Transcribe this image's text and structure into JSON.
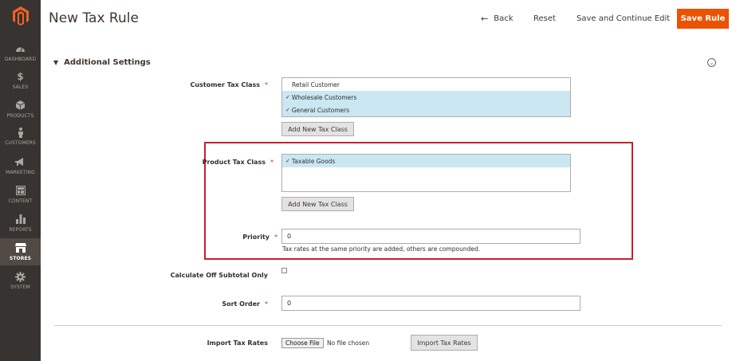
{
  "sidebar": {
    "logo_icon": "magento-logo-icon",
    "items": [
      {
        "label": "DASHBOARD",
        "icon": "dashboard-icon"
      },
      {
        "label": "SALES",
        "icon": "dollar-icon"
      },
      {
        "label": "PRODUCTS",
        "icon": "cube-icon"
      },
      {
        "label": "CUSTOMERS",
        "icon": "person-icon"
      },
      {
        "label": "MARKETING",
        "icon": "megaphone-icon"
      },
      {
        "label": "CONTENT",
        "icon": "layout-icon"
      },
      {
        "label": "REPORTS",
        "icon": "bar-chart-icon"
      },
      {
        "label": "STORES",
        "icon": "store-icon",
        "active": true
      },
      {
        "label": "SYSTEM",
        "icon": "gear-icon"
      }
    ]
  },
  "header": {
    "title": "New Tax Rule",
    "back_label": "Back",
    "reset_label": "Reset",
    "save_continue_label": "Save and Continue Edit",
    "save_rule_label": "Save Rule"
  },
  "section": {
    "title": "Additional Settings"
  },
  "fields": {
    "customer_tax_class": {
      "label": "Customer Tax Class",
      "options": [
        {
          "label": "Retail Customer",
          "selected": false
        },
        {
          "label": "Wholesale Customers",
          "selected": true
        },
        {
          "label": "General Customers",
          "selected": true
        }
      ],
      "add_button": "Add New Tax Class"
    },
    "product_tax_class": {
      "label": "Product Tax Class",
      "options": [
        {
          "label": "Taxable Goods",
          "selected": true
        }
      ],
      "add_button": "Add New Tax Class"
    },
    "priority": {
      "label": "Priority",
      "value": "0",
      "note": "Tax rates at the same priority are added, others are compounded."
    },
    "calc_off_subtotal": {
      "label": "Calculate Off Subtotal Only",
      "checked": false
    },
    "sort_order": {
      "label": "Sort Order",
      "value": "0"
    },
    "import_tax_rates": {
      "label": "Import Tax Rates",
      "choose_file": "Choose File",
      "no_file": "No file chosen",
      "import_button": "Import Tax Rates"
    }
  },
  "colors": {
    "sidebar_bg": "#373330",
    "accent": "#eb5202",
    "selected_option": "#cae7f2",
    "highlight_border": "#c5222b"
  }
}
